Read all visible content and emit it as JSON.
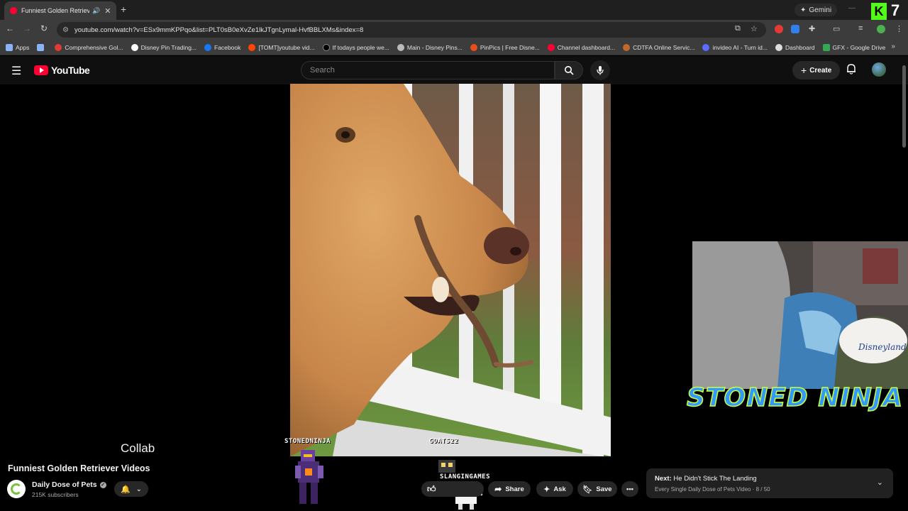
{
  "browser": {
    "tab_title": "Funniest Golden Retriever V",
    "new_tab_symbol": "+",
    "gemini_label": "Gemini",
    "url": "youtube.com/watch?v=ESx9mmKPPqo&list=PLT0sB0eXvZe1lkJTgnLymal-HvfBBLXMs&index=8",
    "corner_overlay_text": "7"
  },
  "bookmarks": [
    {
      "label": "Apps",
      "color": "#8ab4f8"
    },
    {
      "label": "",
      "color": "#8ab4f8"
    },
    {
      "label": "Comprehensive Gol...",
      "color": "#e53935"
    },
    {
      "label": "Disney Pin Trading...",
      "color": "#ffffff"
    },
    {
      "label": "Facebook",
      "color": "#1877f2"
    },
    {
      "label": "[TOMT]youtube vid...",
      "color": "#ff4500"
    },
    {
      "label": "If todays people we...",
      "color": "#000000"
    },
    {
      "label": "Main - Disney Pins...",
      "color": "#bbbbbb"
    },
    {
      "label": "PinPics | Free Disne...",
      "color": "#e84e1b"
    },
    {
      "label": "Channel dashboard...",
      "color": "#ff0033"
    },
    {
      "label": "CDTFA Online Servic...",
      "color": "#c0692d"
    },
    {
      "label": "invideo AI - Turn id...",
      "color": "#5b6cff"
    },
    {
      "label": "Dashboard",
      "color": "#dddddd"
    },
    {
      "label": "GFX - Google Drive",
      "color": "#34a853"
    }
  ],
  "youtube": {
    "brand": "YouTube",
    "search_placeholder": "Search",
    "create_label": "Create"
  },
  "overlays": {
    "collab": "Collab",
    "tag_left": "STONEDNINJA",
    "tag_right": "GOATS22",
    "tag_center": "SLANGINGAMES",
    "webcam_caption": "STONED NINJA",
    "cap_text": "Disneyland"
  },
  "video": {
    "title": "Funniest Golden Retriever Videos",
    "channel": "Daily Dose of Pets",
    "subscribers": "215K subscribers",
    "share_label": "Share",
    "ask_label": "Ask",
    "save_label": "Save"
  },
  "next": {
    "prefix": "Next:",
    "title": "He Didn't Stick The Landing",
    "playlist": "Every Single Daily Dose of Pets Video · 8 / 50"
  }
}
